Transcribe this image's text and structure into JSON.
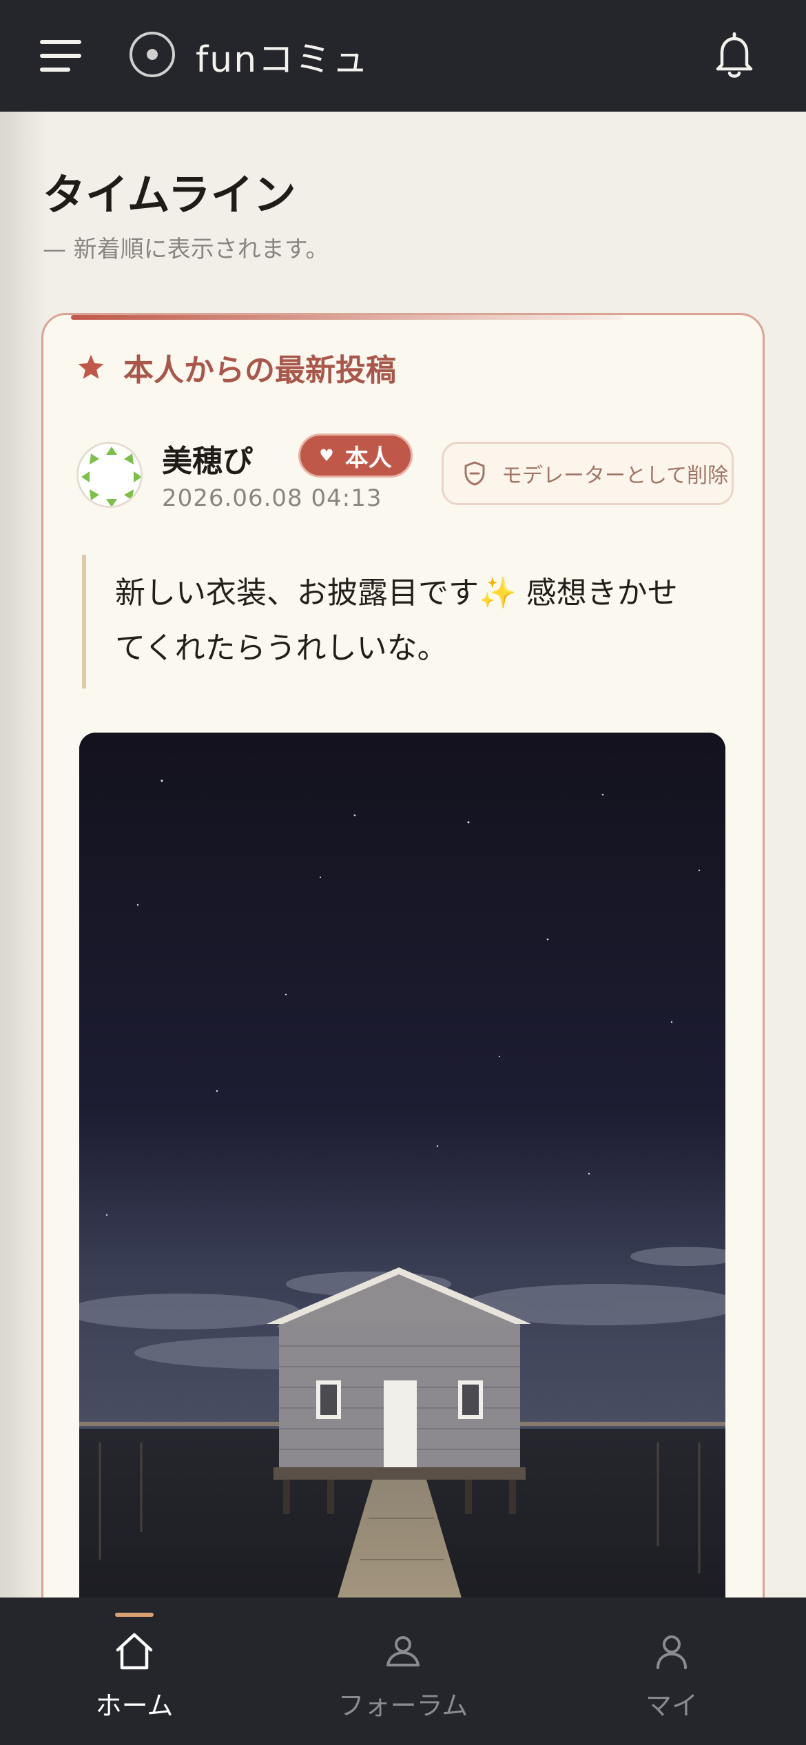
{
  "header": {
    "app_title": "funコミュ",
    "icons": {
      "menu": "menu-icon",
      "logo": "circle-dot-icon",
      "notifications": "bell-icon"
    }
  },
  "timeline": {
    "title": "タイムライン",
    "subtitle": "— 新着順に表示されます。"
  },
  "featured_post": {
    "label": "本人からの最新投稿",
    "author": {
      "name": "美穂ぴ",
      "badge": "本人",
      "badge_icon": "heart-icon"
    },
    "timestamp": "2026.06.08 04:13",
    "moderator_action": "モデレーターとして削除",
    "body_line1": "新しい衣装、お披露目です✨ 感想きかせ",
    "body_line2": "てくれたらうれしいな。",
    "image_description_icon": "photo-boathouse-night"
  },
  "bottom_nav": {
    "items": [
      {
        "label": "ホーム",
        "icon": "home-icon",
        "active": true
      },
      {
        "label": "フォーラム",
        "icon": "forum-icon",
        "active": false
      },
      {
        "label": "マイ",
        "icon": "user-icon",
        "active": false
      }
    ]
  },
  "colors": {
    "topbar": "#25262b",
    "accent": "#c0584a",
    "accent_text": "#a9574b",
    "card_border": "#d9a494",
    "nav_active": "#ffffff",
    "nav_inactive": "#8a8b90"
  }
}
